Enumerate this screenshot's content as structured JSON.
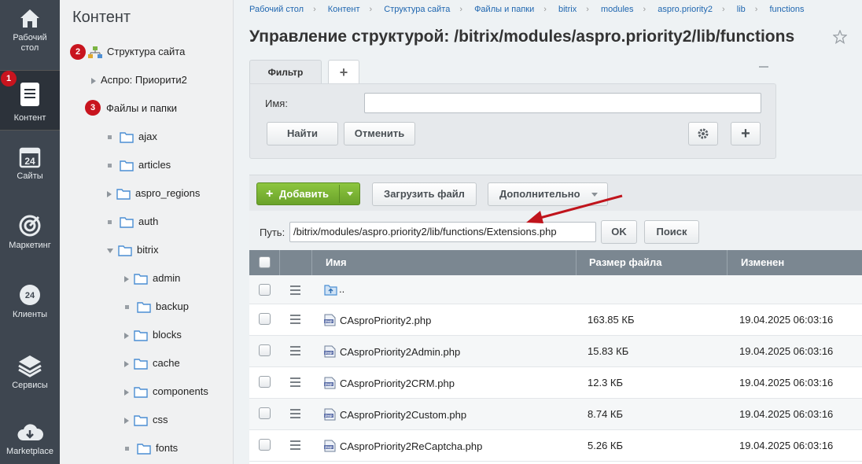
{
  "leftnav": {
    "items": [
      {
        "label": "Рабочий стол",
        "icon": "home-icon"
      },
      {
        "label": "Контент",
        "icon": "document-icon"
      },
      {
        "label": "Сайты",
        "icon": "calendar-icon"
      },
      {
        "label": "Маркетинг",
        "icon": "target-icon"
      },
      {
        "label": "Клиенты",
        "icon": "clients-icon"
      },
      {
        "label": "Сервисы",
        "icon": "layers-icon"
      },
      {
        "label": "Marketplace",
        "icon": "cloud-download-icon"
      }
    ],
    "badge1": "1"
  },
  "tree": {
    "title": "Контент",
    "badge2": "2",
    "badge3": "3",
    "site_structure": "Структура сайта",
    "aspro": "Аспро: Приорити2",
    "files": "Файлы и папки",
    "folders": [
      "ajax",
      "articles",
      "aspro_regions",
      "auth",
      "bitrix"
    ],
    "bitrix_children": [
      "admin",
      "backup",
      "blocks",
      "cache",
      "components",
      "css",
      "fonts"
    ]
  },
  "breadcrumb": [
    "Рабочий стол",
    "Контент",
    "Структура сайта",
    "Файлы и папки",
    "bitrix",
    "modules",
    "aspro.priority2",
    "lib",
    "functions"
  ],
  "page_title": "Управление структурой: /bitrix/modules/aspro.priority2/lib/functions",
  "filter": {
    "tab_label": "Фильтр",
    "add_tab": "+",
    "name_label": "Имя:",
    "name_value": "",
    "find_label": "Найти",
    "cancel_label": "Отменить",
    "add_label": "+"
  },
  "toolbar": {
    "add_label": "Добавить",
    "upload_label": "Загрузить файл",
    "more_label": "Дополнительно"
  },
  "path": {
    "label": "Путь:",
    "value": "/bitrix/modules/aspro.priority2/lib/functions/Extensions.php",
    "ok_label": "OK",
    "search_label": "Поиск"
  },
  "table": {
    "headers": {
      "name": "Имя",
      "size": "Размер файла",
      "modified": "Изменен"
    },
    "up_label": "..",
    "rows": [
      {
        "name": "CAsproPriority2.php",
        "size": "163.85 КБ",
        "modified": "19.04.2025 06:03:16"
      },
      {
        "name": "CAsproPriority2Admin.php",
        "size": "15.83 КБ",
        "modified": "19.04.2025 06:03:16"
      },
      {
        "name": "CAsproPriority2CRM.php",
        "size": "12.3 КБ",
        "modified": "19.04.2025 06:03:16"
      },
      {
        "name": "CAsproPriority2Custom.php",
        "size": "8.74 КБ",
        "modified": "19.04.2025 06:03:16"
      },
      {
        "name": "CAsproPriority2ReCaptcha.php",
        "size": "5.26 КБ",
        "modified": "19.04.2025 06:03:16"
      }
    ]
  },
  "colors": {
    "accent_green": "#7ab535",
    "badge_red": "#c8141e",
    "nav_dark": "#3e4650",
    "arrow_red": "#c0141c"
  }
}
